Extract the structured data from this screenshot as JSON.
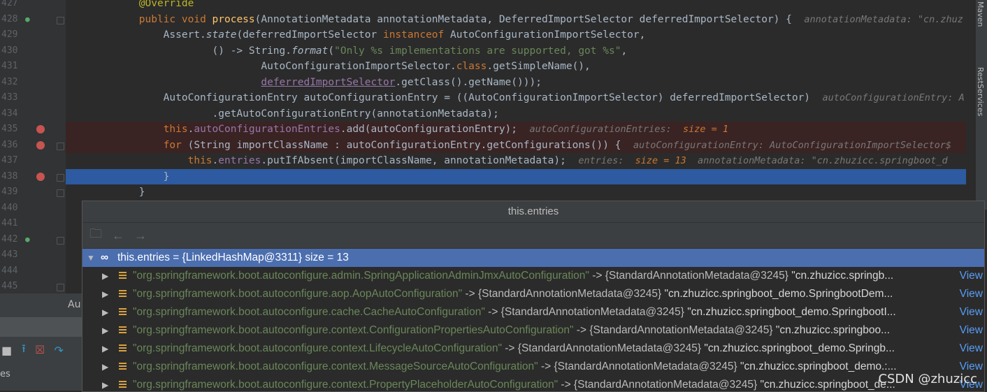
{
  "editor": {
    "lines": [
      {
        "num": "427",
        "segs": [
          [
            "            ",
            ""
          ],
          [
            "@Override",
            "an"
          ]
        ]
      },
      {
        "num": "428",
        "segs": [
          [
            "            ",
            ""
          ],
          [
            "public void ",
            "kw"
          ],
          [
            "process",
            "fn"
          ],
          [
            "(AnnotationMetadata annotationMetadata, DeferredImportSelector deferredImportSelector) {  ",
            ""
          ],
          [
            "annotationMetadata: \"cn.zhuz",
            "hint"
          ]
        ]
      },
      {
        "num": "429",
        "segs": [
          [
            "                Assert.",
            ""
          ],
          [
            "state",
            "it"
          ],
          [
            "(deferredImportSelector ",
            ""
          ],
          [
            "instanceof ",
            "kw"
          ],
          [
            "AutoConfigurationImportSelector,",
            ""
          ]
        ]
      },
      {
        "num": "430",
        "segs": [
          [
            "                        () -> String.",
            ""
          ],
          [
            "format",
            "it"
          ],
          [
            "(",
            ""
          ],
          [
            "\"Only %s implementations are supported, got %s\"",
            "str"
          ],
          [
            ",",
            ""
          ]
        ]
      },
      {
        "num": "431",
        "segs": [
          [
            "                                AutoConfigurationImportSelector.",
            ""
          ],
          [
            "class",
            "kw"
          ],
          [
            ".getSimpleName(),",
            ""
          ]
        ]
      },
      {
        "num": "432",
        "segs": [
          [
            "                                ",
            ""
          ],
          [
            "deferredImportSelector",
            "ul"
          ],
          [
            ".getClass().getName()));",
            ""
          ]
        ]
      },
      {
        "num": "433",
        "segs": [
          [
            "                AutoConfigurationEntry autoConfigurationEntry = ((AutoConfigurationImportSelector) deferredImportSelector)  ",
            ""
          ],
          [
            "autoConfigurationEntry: A",
            "hint"
          ]
        ]
      },
      {
        "num": "434",
        "segs": [
          [
            "                        .getAutoConfigurationEntry(annotationMetadata);",
            ""
          ]
        ]
      },
      {
        "num": "435",
        "segs": [
          [
            "                ",
            ""
          ],
          [
            "this",
            "kw"
          ],
          [
            ".",
            ""
          ],
          [
            "autoConfigurationEntries",
            "fld"
          ],
          [
            ".add(autoConfigurationEntry);  ",
            ""
          ],
          [
            "autoConfigurationEntries:  ",
            "hint"
          ],
          [
            "size = 1",
            "hv"
          ]
        ]
      },
      {
        "num": "436",
        "segs": [
          [
            "                ",
            ""
          ],
          [
            "for ",
            "kw"
          ],
          [
            "(String importClassName : autoConfigurationEntry.getConfigurations()) {  ",
            ""
          ],
          [
            "autoConfigurationEntry: AutoConfigurationImportSelector$",
            "hint"
          ]
        ]
      },
      {
        "num": "437",
        "segs": [
          [
            "                    ",
            ""
          ],
          [
            "this",
            "kw"
          ],
          [
            ".",
            ""
          ],
          [
            "entries",
            "fld"
          ],
          [
            ".putIfAbsent(importClassName, annotationMetadata);  ",
            ""
          ],
          [
            "entries:  ",
            "hint"
          ],
          [
            "size = 13",
            "hv"
          ],
          [
            "  annotationMetadata: \"cn.zhuzicc.springboot_d",
            "hint"
          ]
        ]
      },
      {
        "num": "438",
        "segs": [
          [
            "                }",
            ""
          ]
        ]
      },
      {
        "num": "439",
        "segs": [
          [
            "            }",
            ""
          ]
        ]
      },
      {
        "num": "440",
        "segs": []
      },
      {
        "num": "441",
        "segs": []
      },
      {
        "num": "442",
        "segs": []
      },
      {
        "num": "443",
        "segs": []
      },
      {
        "num": "444",
        "segs": []
      },
      {
        "num": "445",
        "segs": []
      }
    ]
  },
  "rightbar": {
    "maven": "Maven",
    "rest": "RestServices"
  },
  "bottom": {
    "tab": "Au",
    "es": "es"
  },
  "popup": {
    "title": "this.entries",
    "root": {
      "label": "this.entries = {LinkedHashMap@3311}  size = 13"
    },
    "rows": [
      {
        "key": "\"org.springframework.boot.autoconfigure.admin.SpringApplicationAdminJmxAutoConfiguration\"",
        "arrow": " -> {StandardAnnotationMetadata@3245} ",
        "val": "\"cn.zhuzicc.springb...",
        "view": "View"
      },
      {
        "key": "\"org.springframework.boot.autoconfigure.aop.AopAutoConfiguration\"",
        "arrow": " -> {StandardAnnotationMetadata@3245} ",
        "val": "\"cn.zhuzicc.springboot_demo.SpringbootDem...",
        "view": "View"
      },
      {
        "key": "\"org.springframework.boot.autoconfigure.cache.CacheAutoConfiguration\"",
        "arrow": " -> {StandardAnnotationMetadata@3245} ",
        "val": "\"cn.zhuzicc.springboot_demo.SpringbootI...",
        "view": "View"
      },
      {
        "key": "\"org.springframework.boot.autoconfigure.context.ConfigurationPropertiesAutoConfiguration\"",
        "arrow": " -> {StandardAnnotationMetadata@3245} ",
        "val": "\"cn.zhuzicc.springboo...",
        "view": "View"
      },
      {
        "key": "\"org.springframework.boot.autoconfigure.context.LifecycleAutoConfiguration\"",
        "arrow": " -> {StandardAnnotationMetadata@3245} ",
        "val": "\"cn.zhuzicc.springboot_demo.Springb...",
        "view": "View"
      },
      {
        "key": "\"org.springframework.boot.autoconfigure.context.MessageSourceAutoConfiguration\"",
        "arrow": " -> {StandardAnnotationMetadata@3245} ",
        "val": "\"cn.zhuzicc.springboot_demo.:...",
        "view": "View"
      },
      {
        "key": "\"org.springframework.boot.autoconfigure.context.PropertyPlaceholderAutoConfiguration\"",
        "arrow": " -> {StandardAnnotationMetadata@3245} ",
        "val": "\"cn.zhuzicc.springboot_de...",
        "view": "View"
      }
    ]
  },
  "watermark": "CSDN @zhuzicc"
}
